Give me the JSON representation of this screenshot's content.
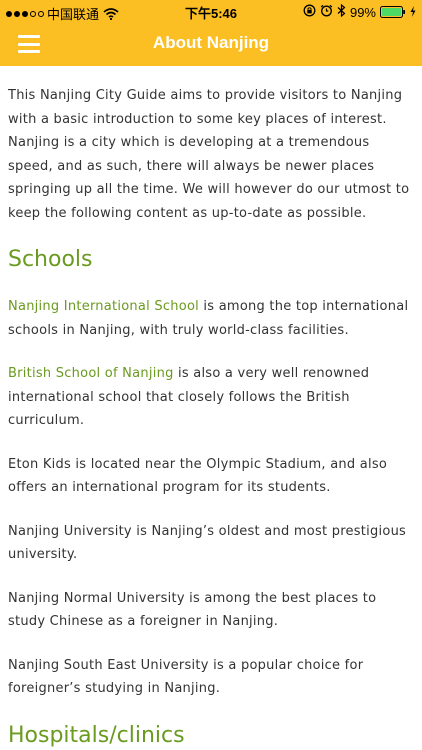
{
  "status_bar": {
    "carrier": "中国联通",
    "time": "下午5:46",
    "battery": "99%"
  },
  "navbar": {
    "title": "About Nanjing"
  },
  "intro": "This Nanjing City Guide aims to provide visitors to Nanjing with a basic introduction to some key places of interest. Nanjing is a city which is developing at a tremendous speed, and as such, there will always be newer places springing up all the time.  We will however do our utmost to keep the following content as up-to-date as possible.",
  "sections": {
    "schools": {
      "heading": "Schools",
      "items": [
        {
          "link": "Nanjing International School",
          "text": " is among the top international schools in Nanjing, with truly world-class facilities."
        },
        {
          "link": "British School of Nanjing",
          "text": " is also a very well renowned international school that closely follows the British curriculum."
        },
        {
          "text": "Eton Kids is located near the Olympic Stadium, and also offers an international program for its students."
        },
        {
          "text": "Nanjing University is Nanjing’s oldest and most prestigious university."
        },
        {
          "text": "Nanjing Normal University is among the best places to study Chinese as a foreigner in Nanjing."
        },
        {
          "text": "Nanjing South East University is a popular choice for foreigner’s studying in Nanjing."
        }
      ]
    },
    "hospitals": {
      "heading": "Hospitals/clinics"
    }
  },
  "colors": {
    "header": "#fbbf24",
    "accent_green": "#6a9a20",
    "body_text": "#333333"
  }
}
